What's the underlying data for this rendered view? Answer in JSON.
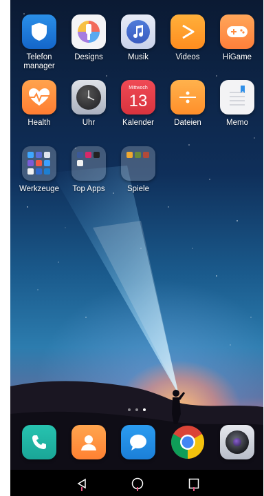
{
  "apps_row1": [
    {
      "label": "Telefon\nmanager",
      "icon": "shield-icon"
    },
    {
      "label": "Designs",
      "icon": "paintbrush-icon"
    },
    {
      "label": "Musik",
      "icon": "music-note-icon"
    },
    {
      "label": "Videos",
      "icon": "play-icon"
    },
    {
      "label": "HiGame",
      "icon": "gamepad-icon"
    }
  ],
  "apps_row2": [
    {
      "label": "Health",
      "icon": "heart-pulse-icon"
    },
    {
      "label": "Uhr",
      "icon": "clock-icon"
    },
    {
      "label": "Kalender",
      "icon": "calendar-icon",
      "weekday": "Mittwoch",
      "day": "13"
    },
    {
      "label": "Dateien",
      "icon": "folder-icon"
    },
    {
      "label": "Memo",
      "icon": "notepad-icon"
    }
  ],
  "folders": [
    {
      "label": "Werkzeuge"
    },
    {
      "label": "Top Apps"
    },
    {
      "label": "Spiele"
    }
  ],
  "dock": [
    "phone-icon",
    "contacts-icon",
    "messages-icon",
    "chrome-icon",
    "camera-icon"
  ],
  "page_indicator": {
    "pages": 3,
    "current": 3
  },
  "colors": {
    "accent": "#e75480"
  }
}
